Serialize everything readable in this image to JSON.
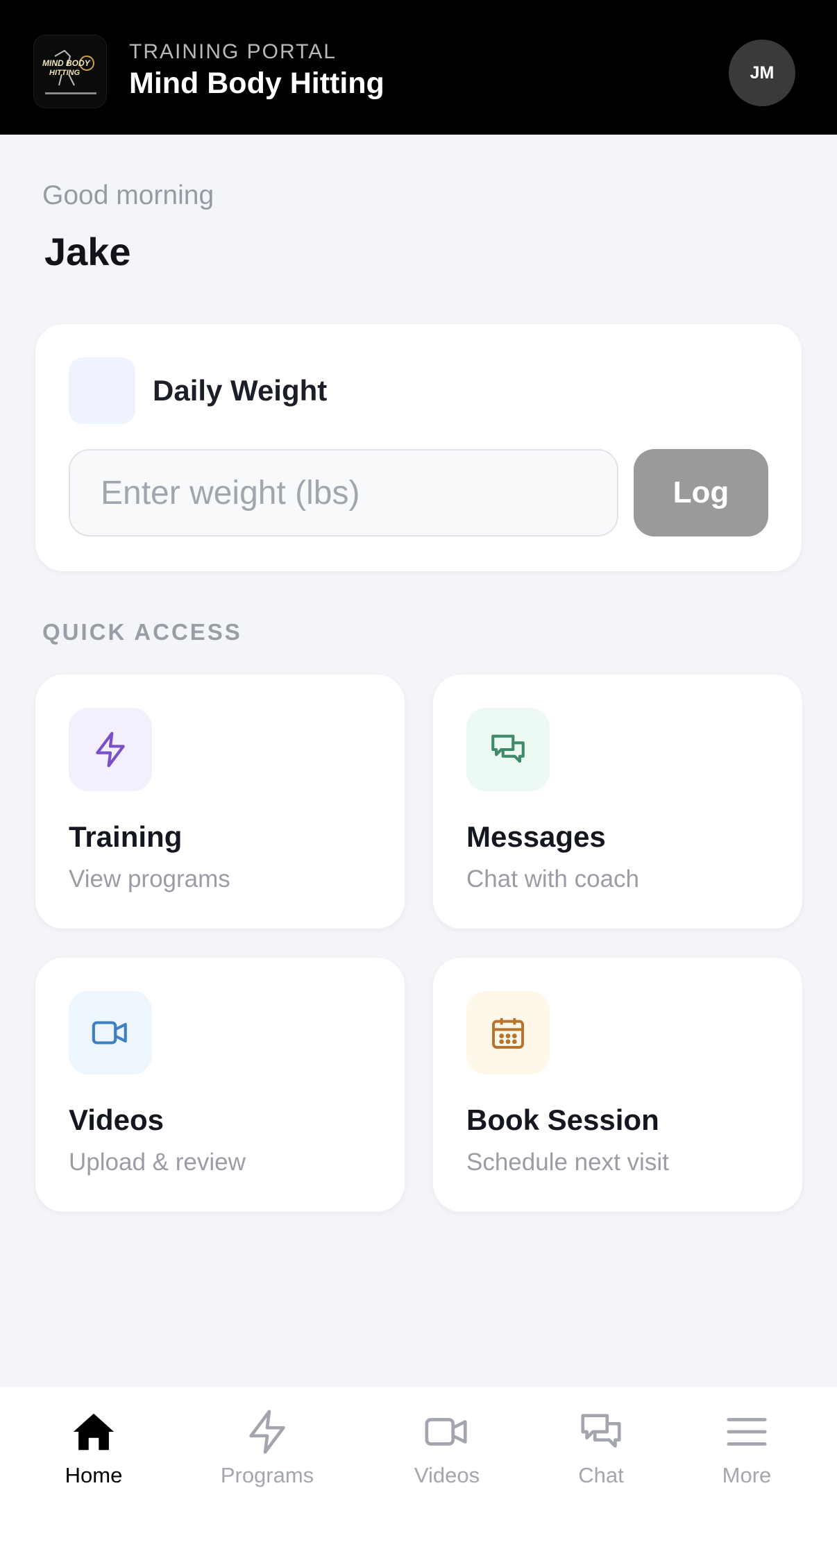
{
  "header": {
    "portal_label": "TRAINING PORTAL",
    "app_title": "Mind Body Hitting",
    "avatar_initials": "JM",
    "logo_text_line1": "MIND BODY",
    "logo_text_line2": "HITTING"
  },
  "greeting": {
    "salutation": "Good morning",
    "name": "Jake"
  },
  "weight_card": {
    "title": "Daily Weight",
    "input_placeholder": "Enter weight (lbs)",
    "input_value": "",
    "button_label": "Log"
  },
  "quick_access": {
    "label": "QUICK ACCESS",
    "tiles": [
      {
        "title": "Training",
        "subtitle": "View programs",
        "icon": "bolt-icon",
        "color": "#7b4fc9",
        "bg": "#f4effd"
      },
      {
        "title": "Messages",
        "subtitle": "Chat with coach",
        "icon": "chat-icon",
        "color": "#3f8a68",
        "bg": "#edf9f3"
      },
      {
        "title": "Videos",
        "subtitle": "Upload & review",
        "icon": "video-icon",
        "color": "#3d7fc0",
        "bg": "#edf5fd"
      },
      {
        "title": "Book Session",
        "subtitle": "Schedule next visit",
        "icon": "calendar-icon",
        "color": "#b8742c",
        "bg": "#fdf8ea"
      }
    ]
  },
  "bottom_nav": {
    "items": [
      {
        "label": "Home",
        "icon": "home-icon",
        "active": true
      },
      {
        "label": "Programs",
        "icon": "bolt-icon",
        "active": false
      },
      {
        "label": "Videos",
        "icon": "video-icon",
        "active": false
      },
      {
        "label": "Chat",
        "icon": "chat-icon",
        "active": false
      },
      {
        "label": "More",
        "icon": "menu-icon",
        "active": false
      }
    ]
  },
  "colors": {
    "header_bg": "#000000",
    "page_bg": "#f4f5f9",
    "log_button_bg": "#9a9a9a",
    "nav_active": "#000000",
    "nav_inactive": "#a3a6ae"
  }
}
